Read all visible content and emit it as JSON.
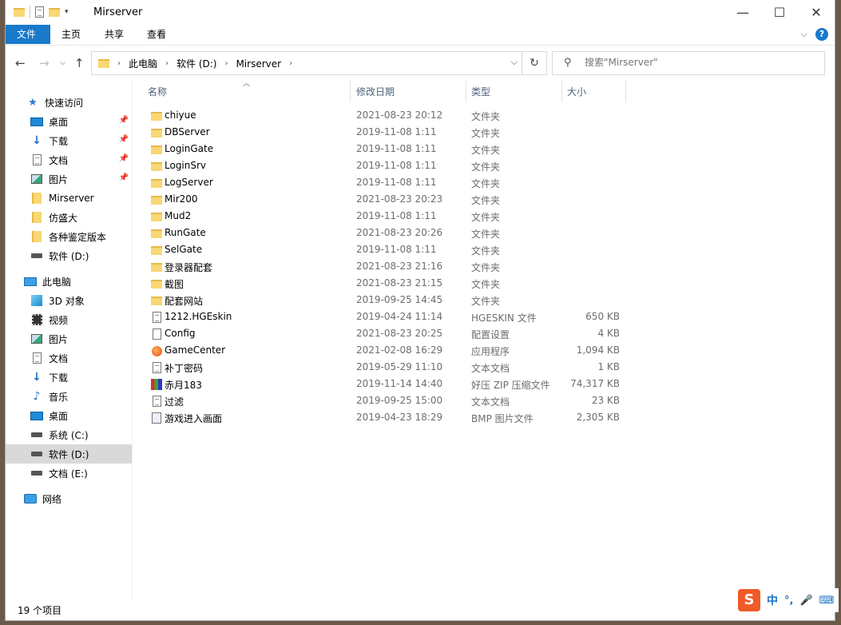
{
  "window": {
    "title": "Mirserver"
  },
  "ribbon": {
    "tabs": [
      "文件",
      "主页",
      "共享",
      "查看"
    ],
    "help": "?"
  },
  "address": {
    "crumbs": [
      "此电脑",
      "软件 (D:)",
      "Mirserver"
    ]
  },
  "search": {
    "placeholder": "搜索\"Mirserver\""
  },
  "sidebar": {
    "items": [
      {
        "label": "快速访问",
        "icon": "star-icon"
      },
      {
        "label": "桌面",
        "icon": "desktop-icon",
        "pinned": true
      },
      {
        "label": "下载",
        "icon": "download-icon",
        "pinned": true
      },
      {
        "label": "文档",
        "icon": "document-icon",
        "pinned": true
      },
      {
        "label": "图片",
        "icon": "picture-icon",
        "pinned": true
      },
      {
        "label": "Mirserver",
        "icon": "folder-icon"
      },
      {
        "label": "仿盛大",
        "icon": "folder-icon"
      },
      {
        "label": "各种鉴定版本",
        "icon": "folder-icon"
      },
      {
        "label": "软件 (D:)",
        "icon": "drive-icon"
      },
      {
        "label": "此电脑",
        "icon": "computer-icon"
      },
      {
        "label": "3D 对象",
        "icon": "3d-objects-icon"
      },
      {
        "label": "视频",
        "icon": "video-icon"
      },
      {
        "label": "图片",
        "icon": "picture-icon"
      },
      {
        "label": "文档",
        "icon": "document-icon"
      },
      {
        "label": "下载",
        "icon": "download-icon"
      },
      {
        "label": "音乐",
        "icon": "music-icon"
      },
      {
        "label": "桌面",
        "icon": "desktop-icon"
      },
      {
        "label": "系统 (C:)",
        "icon": "drive-icon"
      },
      {
        "label": "软件 (D:)",
        "icon": "drive-icon",
        "selected": true
      },
      {
        "label": "文档 (E:)",
        "icon": "drive-icon"
      },
      {
        "label": "网络",
        "icon": "network-icon"
      }
    ]
  },
  "columns": {
    "name": "名称",
    "date": "修改日期",
    "type": "类型",
    "size": "大小"
  },
  "files": [
    {
      "name": "chiyue",
      "date": "2021-08-23 20:12",
      "type": "文件夹",
      "size": "",
      "icon": "folder"
    },
    {
      "name": "DBServer",
      "date": "2019-11-08 1:11",
      "type": "文件夹",
      "size": "",
      "icon": "folder"
    },
    {
      "name": "LoginGate",
      "date": "2019-11-08 1:11",
      "type": "文件夹",
      "size": "",
      "icon": "folder"
    },
    {
      "name": "LoginSrv",
      "date": "2019-11-08 1:11",
      "type": "文件夹",
      "size": "",
      "icon": "folder"
    },
    {
      "name": "LogServer",
      "date": "2019-11-08 1:11",
      "type": "文件夹",
      "size": "",
      "icon": "folder"
    },
    {
      "name": "Mir200",
      "date": "2021-08-23 20:23",
      "type": "文件夹",
      "size": "",
      "icon": "folder"
    },
    {
      "name": "Mud2",
      "date": "2019-11-08 1:11",
      "type": "文件夹",
      "size": "",
      "icon": "folder"
    },
    {
      "name": "RunGate",
      "date": "2021-08-23 20:26",
      "type": "文件夹",
      "size": "",
      "icon": "folder"
    },
    {
      "name": "SelGate",
      "date": "2019-11-08 1:11",
      "type": "文件夹",
      "size": "",
      "icon": "folder"
    },
    {
      "name": "登录器配套",
      "date": "2021-08-23 21:16",
      "type": "文件夹",
      "size": "",
      "icon": "folder"
    },
    {
      "name": "截图",
      "date": "2021-08-23 21:15",
      "type": "文件夹",
      "size": "",
      "icon": "folder"
    },
    {
      "name": "配套网站",
      "date": "2019-09-25 14:45",
      "type": "文件夹",
      "size": "",
      "icon": "folder"
    },
    {
      "name": "1212.HGEskin",
      "date": "2019-04-24 11:14",
      "type": "HGESKIN 文件",
      "size": "650 KB",
      "icon": "file"
    },
    {
      "name": "Config",
      "date": "2021-08-23 20:25",
      "type": "配置设置",
      "size": "4 KB",
      "icon": "config"
    },
    {
      "name": "GameCenter",
      "date": "2021-02-08 16:29",
      "type": "应用程序",
      "size": "1,094 KB",
      "icon": "app"
    },
    {
      "name": "补丁密码",
      "date": "2019-05-29 11:10",
      "type": "文本文档",
      "size": "1 KB",
      "icon": "text"
    },
    {
      "name": "赤月183",
      "date": "2019-11-14 14:40",
      "type": "好压 ZIP 压缩文件",
      "size": "74,317 KB",
      "icon": "zip"
    },
    {
      "name": "过滤",
      "date": "2019-09-25 15:00",
      "type": "文本文档",
      "size": "23 KB",
      "icon": "text"
    },
    {
      "name": "游戏进入画面",
      "date": "2019-04-23 18:29",
      "type": "BMP 图片文件",
      "size": "2,305 KB",
      "icon": "bmp"
    }
  ],
  "status": {
    "count": "19 个项目"
  },
  "ime": {
    "logo": "S",
    "lang": "中",
    "punct": "°,"
  }
}
